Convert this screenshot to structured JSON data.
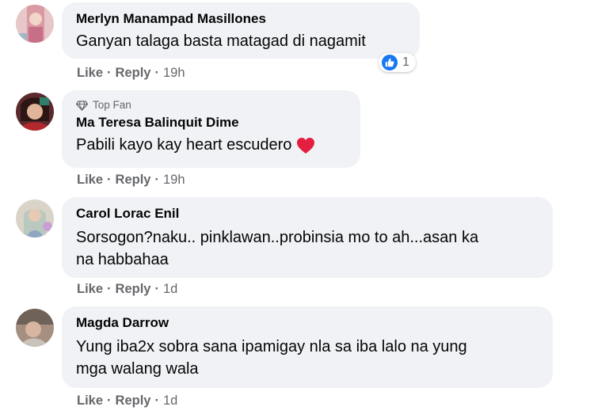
{
  "actions": {
    "like": "Like",
    "reply": "Reply",
    "separator": "·"
  },
  "colors": {
    "bubble": "#f0f2f5",
    "meta": "#65676b",
    "like_blue": "#1877f2",
    "heart_red": "#e41e3f"
  },
  "comments": [
    {
      "author": "Merlyn Manampad Masillones",
      "text": "Ganyan talaga basta matagad di nagamit",
      "time": "19h",
      "reaction": {
        "icon": "like-icon",
        "count": "1"
      }
    },
    {
      "badge": "Top Fan",
      "badge_icon": "diamond-icon",
      "author": "Ma Teresa Balinquit Dime",
      "text": "Pabili kayo kay heart escudero",
      "emoji": "heart-icon",
      "time": "19h"
    },
    {
      "author": "Carol Lorac Enil",
      "text_line1": "Sorsogon?naku.. pinklawan..probinsia mo to ah...asan ka",
      "text_line2": "na habbahaa",
      "time": "1d"
    },
    {
      "author": "Magda Darrow",
      "text_line1": "Yung iba2x sobra sana ipamigay nla sa iba lalo na yung",
      "text_line2": "mga walang wala",
      "time": "1d"
    }
  ]
}
